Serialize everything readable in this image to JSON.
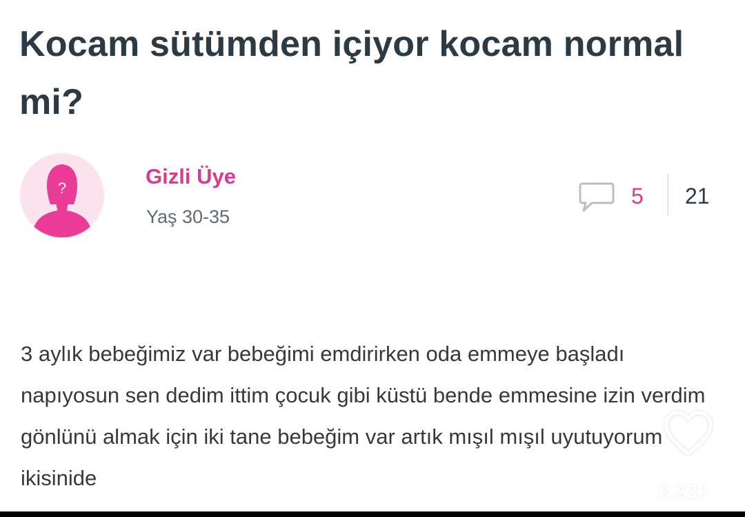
{
  "post": {
    "title": "Kocam sütümden içiyor kocam normal mi?",
    "body": "3 aylık bebeğimiz var bebeğimi emdirirken oda emmeye başladı napıyosun sen dedim ittim çocuk gibi küstü bende emmesine izin verdim gönlünü almak için iki tane bebeğim var artık mışıl mışıl uyutuyorum ikisinide"
  },
  "author": {
    "name": "Gizli Üye",
    "age": "Yaş 30-35",
    "avatar_icon": "anonymous-woman-icon",
    "avatar_glyph": "?"
  },
  "stats": {
    "comment_icon": "comment-bubble-icon",
    "comment_count": "5",
    "view_count": "21"
  },
  "overlay": {
    "like_icon": "heart-outline-icon",
    "like_count": "2.230"
  },
  "colors": {
    "brand_pink": "#d93c8e",
    "avatar_bg": "#fbe3ee",
    "title_text": "#2c3a43",
    "body_text": "#36393c",
    "meta_text": "#616a70"
  }
}
